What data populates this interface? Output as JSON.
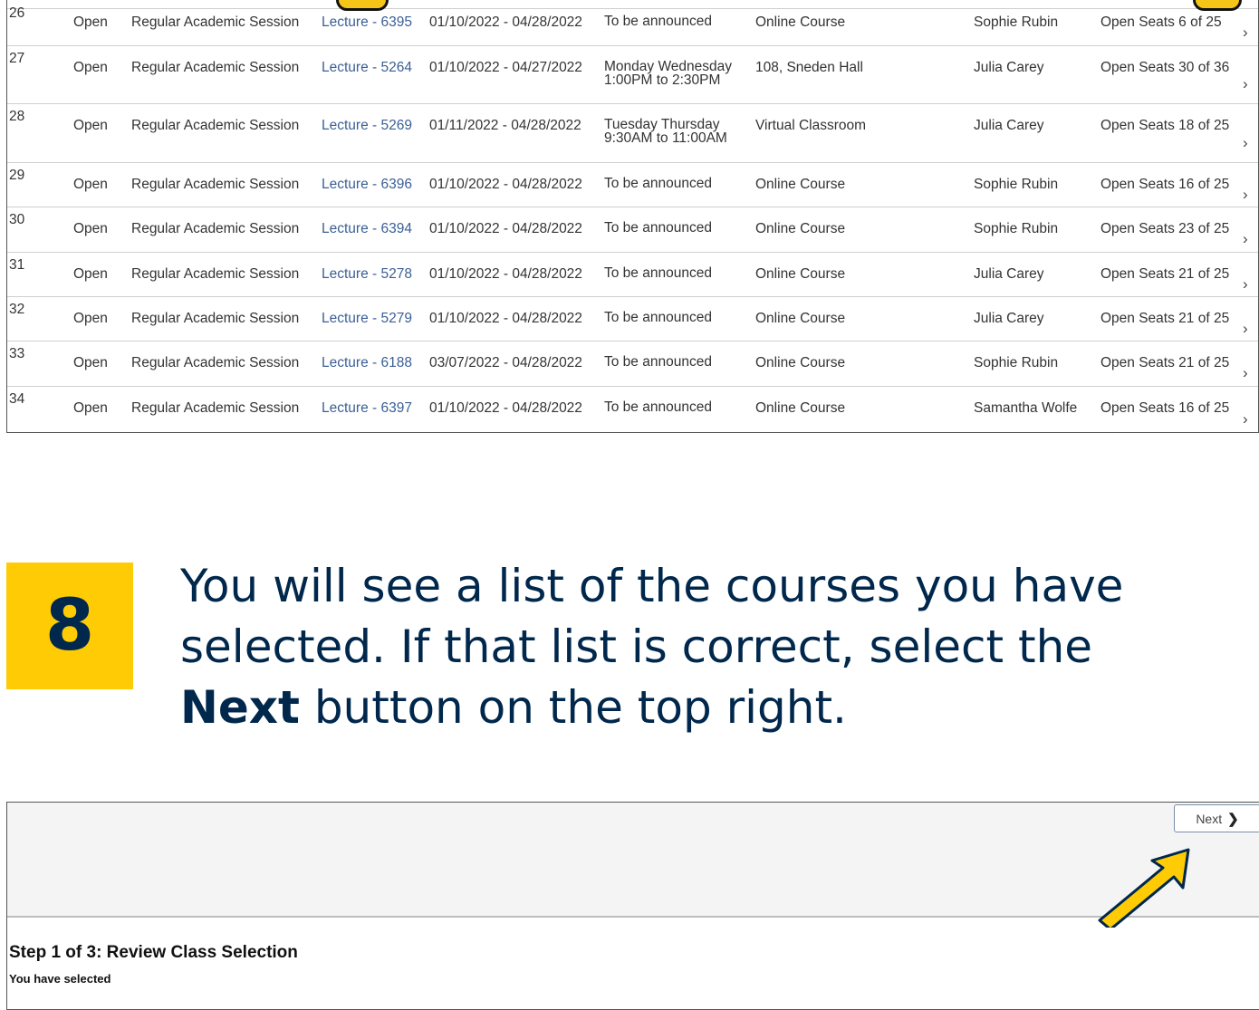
{
  "class_rows": [
    {
      "num": "26",
      "status": "Open",
      "session": "Regular Academic Session",
      "section": "Lecture - 6395",
      "dates": "01/10/2022 - 04/28/2022",
      "time": [
        "To be announced"
      ],
      "room": "Online Course",
      "instructor": "Sophie Rubin",
      "seats": "Open Seats 6 of 25"
    },
    {
      "num": "27",
      "status": "Open",
      "session": "Regular Academic Session",
      "section": "Lecture - 5264",
      "dates": "01/10/2022 - 04/27/2022",
      "time": [
        "Monday Wednesday",
        "1:00PM to 2:30PM"
      ],
      "room": "108, Sneden Hall",
      "instructor": "Julia Carey",
      "seats": "Open Seats 30 of 36"
    },
    {
      "num": "28",
      "status": "Open",
      "session": "Regular Academic Session",
      "section": "Lecture - 5269",
      "dates": "01/11/2022 - 04/28/2022",
      "time": [
        "Tuesday Thursday",
        "9:30AM to 11:00AM"
      ],
      "room": "Virtual Classroom",
      "instructor": "Julia Carey",
      "seats": "Open Seats 18 of 25"
    },
    {
      "num": "29",
      "status": "Open",
      "session": "Regular Academic Session",
      "section": "Lecture - 6396",
      "dates": "01/10/2022 - 04/28/2022",
      "time": [
        "To be announced"
      ],
      "room": "Online Course",
      "instructor": "Sophie Rubin",
      "seats": "Open Seats 16 of 25"
    },
    {
      "num": "30",
      "status": "Open",
      "session": "Regular Academic Session",
      "section": "Lecture - 6394",
      "dates": "01/10/2022 - 04/28/2022",
      "time": [
        "To be announced"
      ],
      "room": "Online Course",
      "instructor": "Sophie Rubin",
      "seats": "Open Seats 23 of 25"
    },
    {
      "num": "31",
      "status": "Open",
      "session": "Regular Academic Session",
      "section": "Lecture - 5278",
      "dates": "01/10/2022 - 04/28/2022",
      "time": [
        "To be announced"
      ],
      "room": "Online Course",
      "instructor": "Julia Carey",
      "seats": "Open Seats 21 of 25"
    },
    {
      "num": "32",
      "status": "Open",
      "session": "Regular Academic Session",
      "section": "Lecture - 5279",
      "dates": "01/10/2022 - 04/28/2022",
      "time": [
        "To be announced"
      ],
      "room": "Online Course",
      "instructor": "Julia Carey",
      "seats": "Open Seats 21 of 25"
    },
    {
      "num": "33",
      "status": "Open",
      "session": "Regular Academic Session",
      "section": "Lecture - 6188",
      "dates": "03/07/2022 - 04/28/2022",
      "time": [
        "To be announced"
      ],
      "room": "Online Course",
      "instructor": "Sophie Rubin",
      "seats": "Open Seats 21 of 25"
    },
    {
      "num": "34",
      "status": "Open",
      "session": "Regular Academic Session",
      "section": "Lecture - 6397",
      "dates": "01/10/2022 - 04/28/2022",
      "time": [
        "To be announced"
      ],
      "room": "Online Course",
      "instructor": "Samantha Wolfe",
      "seats": "Open Seats 16 of 25"
    }
  ],
  "row_chevron": "›",
  "step": {
    "number": "8",
    "text_before": "You will see a list of the courses you have selected. If that list is correct, select the ",
    "text_bold": "Next",
    "text_after": " button on the top right."
  },
  "enroll": {
    "next_label": "Next",
    "next_icon": "chevron-right-icon",
    "step_title": "Step 1 of 3: Review Class Selection",
    "selected_label": "You have selected"
  },
  "colors": {
    "brand_blue": "#00274c",
    "brand_maize": "#ffcb05",
    "link_blue": "#3a5f96"
  }
}
